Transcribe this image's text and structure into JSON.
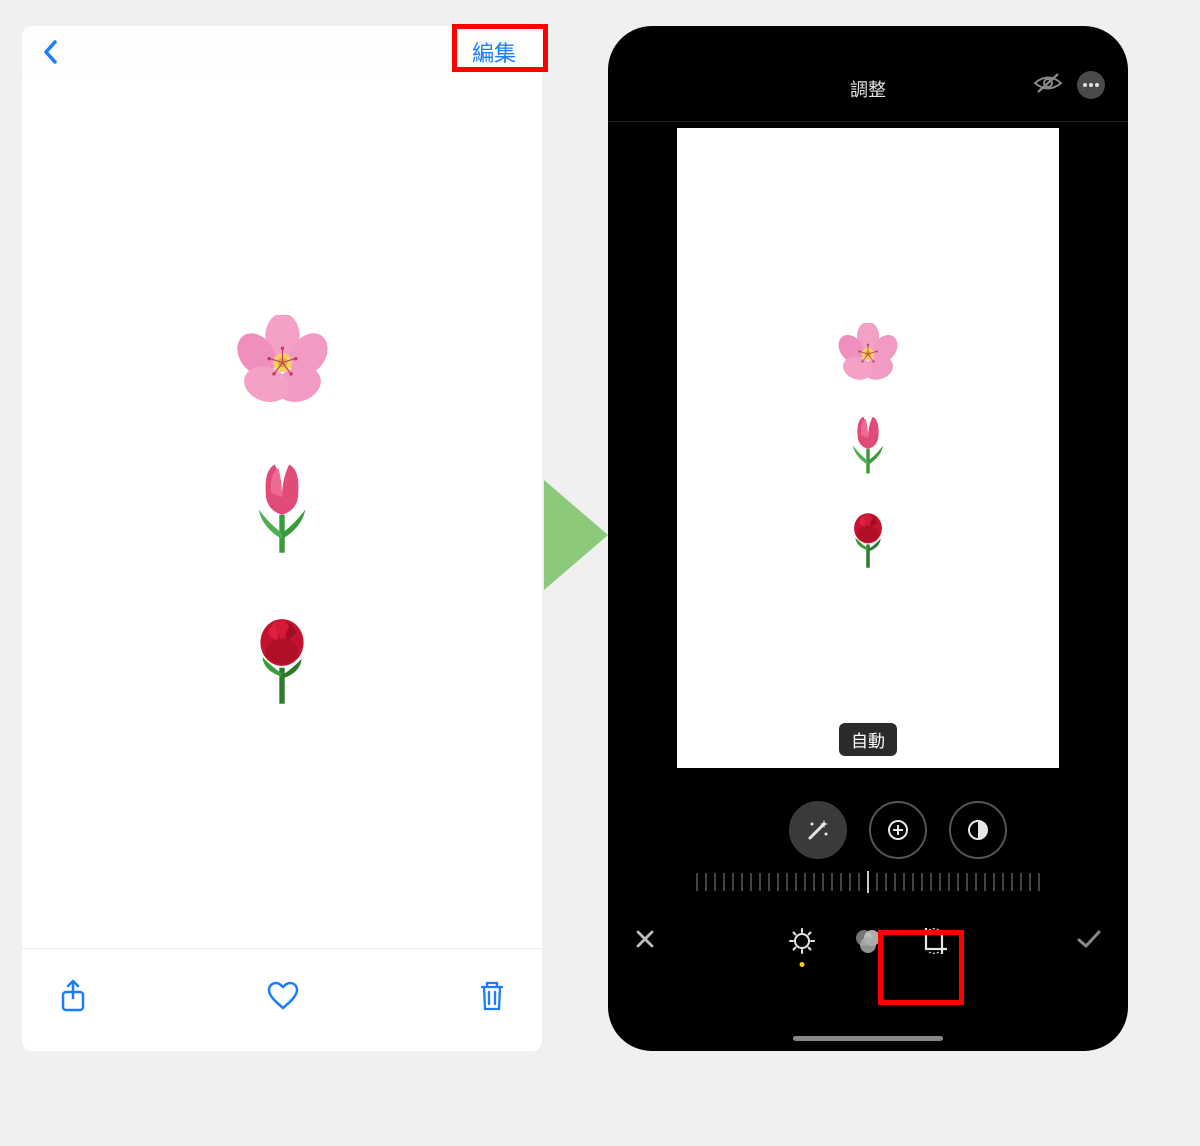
{
  "left_screen": {
    "edit_label": "編集",
    "flowers": [
      "cherry-blossom",
      "tulip",
      "rose"
    ]
  },
  "right_screen": {
    "title": "調整",
    "auto_label": "自動",
    "adjust_tools": [
      "magic-wand",
      "brightness-add",
      "contrast"
    ],
    "modes": [
      "adjust",
      "filters",
      "crop"
    ],
    "flowers": [
      "cherry-blossom",
      "tulip",
      "rose"
    ]
  },
  "annotations": {
    "highlight_edit": true,
    "highlight_crop": true
  },
  "colors": {
    "ios_blue": "#1a7cff",
    "highlight_red": "#ff0000",
    "arrow_green": "#8cc97a"
  }
}
